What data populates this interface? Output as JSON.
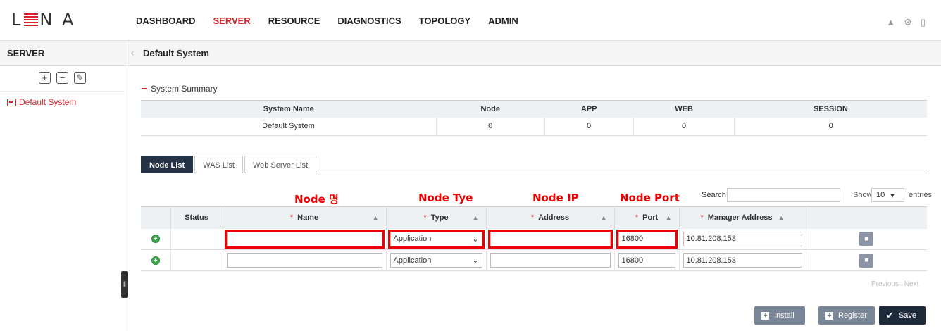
{
  "brand": {
    "logo_left": "L",
    "logo_right": "N A"
  },
  "nav": {
    "items": [
      "DASHBOARD",
      "SERVER",
      "RESOURCE",
      "DIAGNOSTICS",
      "TOPOLOGY",
      "ADMIN"
    ],
    "active": "SERVER"
  },
  "sidebar": {
    "title": "SERVER",
    "tree_item": "Default System"
  },
  "content": {
    "title": "Default System",
    "section_title": "System Summary"
  },
  "summary": {
    "headers": [
      "System Name",
      "Node",
      "APP",
      "WEB",
      "SESSION"
    ],
    "row": [
      "Default System",
      "0",
      "0",
      "0",
      "0"
    ]
  },
  "tabs": [
    "Node List",
    "WAS List",
    "Web Server List"
  ],
  "annotations": {
    "name": "Node 명",
    "type": "Node Tye",
    "ip": "Node IP",
    "port": "Node Port"
  },
  "table_controls": {
    "search_label": "Search",
    "show_label": "Show",
    "show_value": "10",
    "entries_label": "entries"
  },
  "node_table": {
    "headers": [
      "Status",
      "Name",
      "Type",
      "Address",
      "Port",
      "Manager Address"
    ],
    "rows": [
      {
        "name": "",
        "type": "Application",
        "address": "",
        "port": "16800",
        "manager": "10.81.208.153"
      },
      {
        "name": "",
        "type": "Application",
        "address": "",
        "port": "16800",
        "manager": "10.81.208.153"
      }
    ]
  },
  "pagination": {
    "prev": "Previous",
    "next": "Next"
  },
  "buttons": {
    "install": "Install",
    "register": "Register",
    "save": "Save"
  },
  "colors": {
    "accent": "#d9232d",
    "dark": "#1f2a3b",
    "tab_active": "#263245",
    "button_gray": "#7b8798",
    "annotation": "#e00000"
  }
}
